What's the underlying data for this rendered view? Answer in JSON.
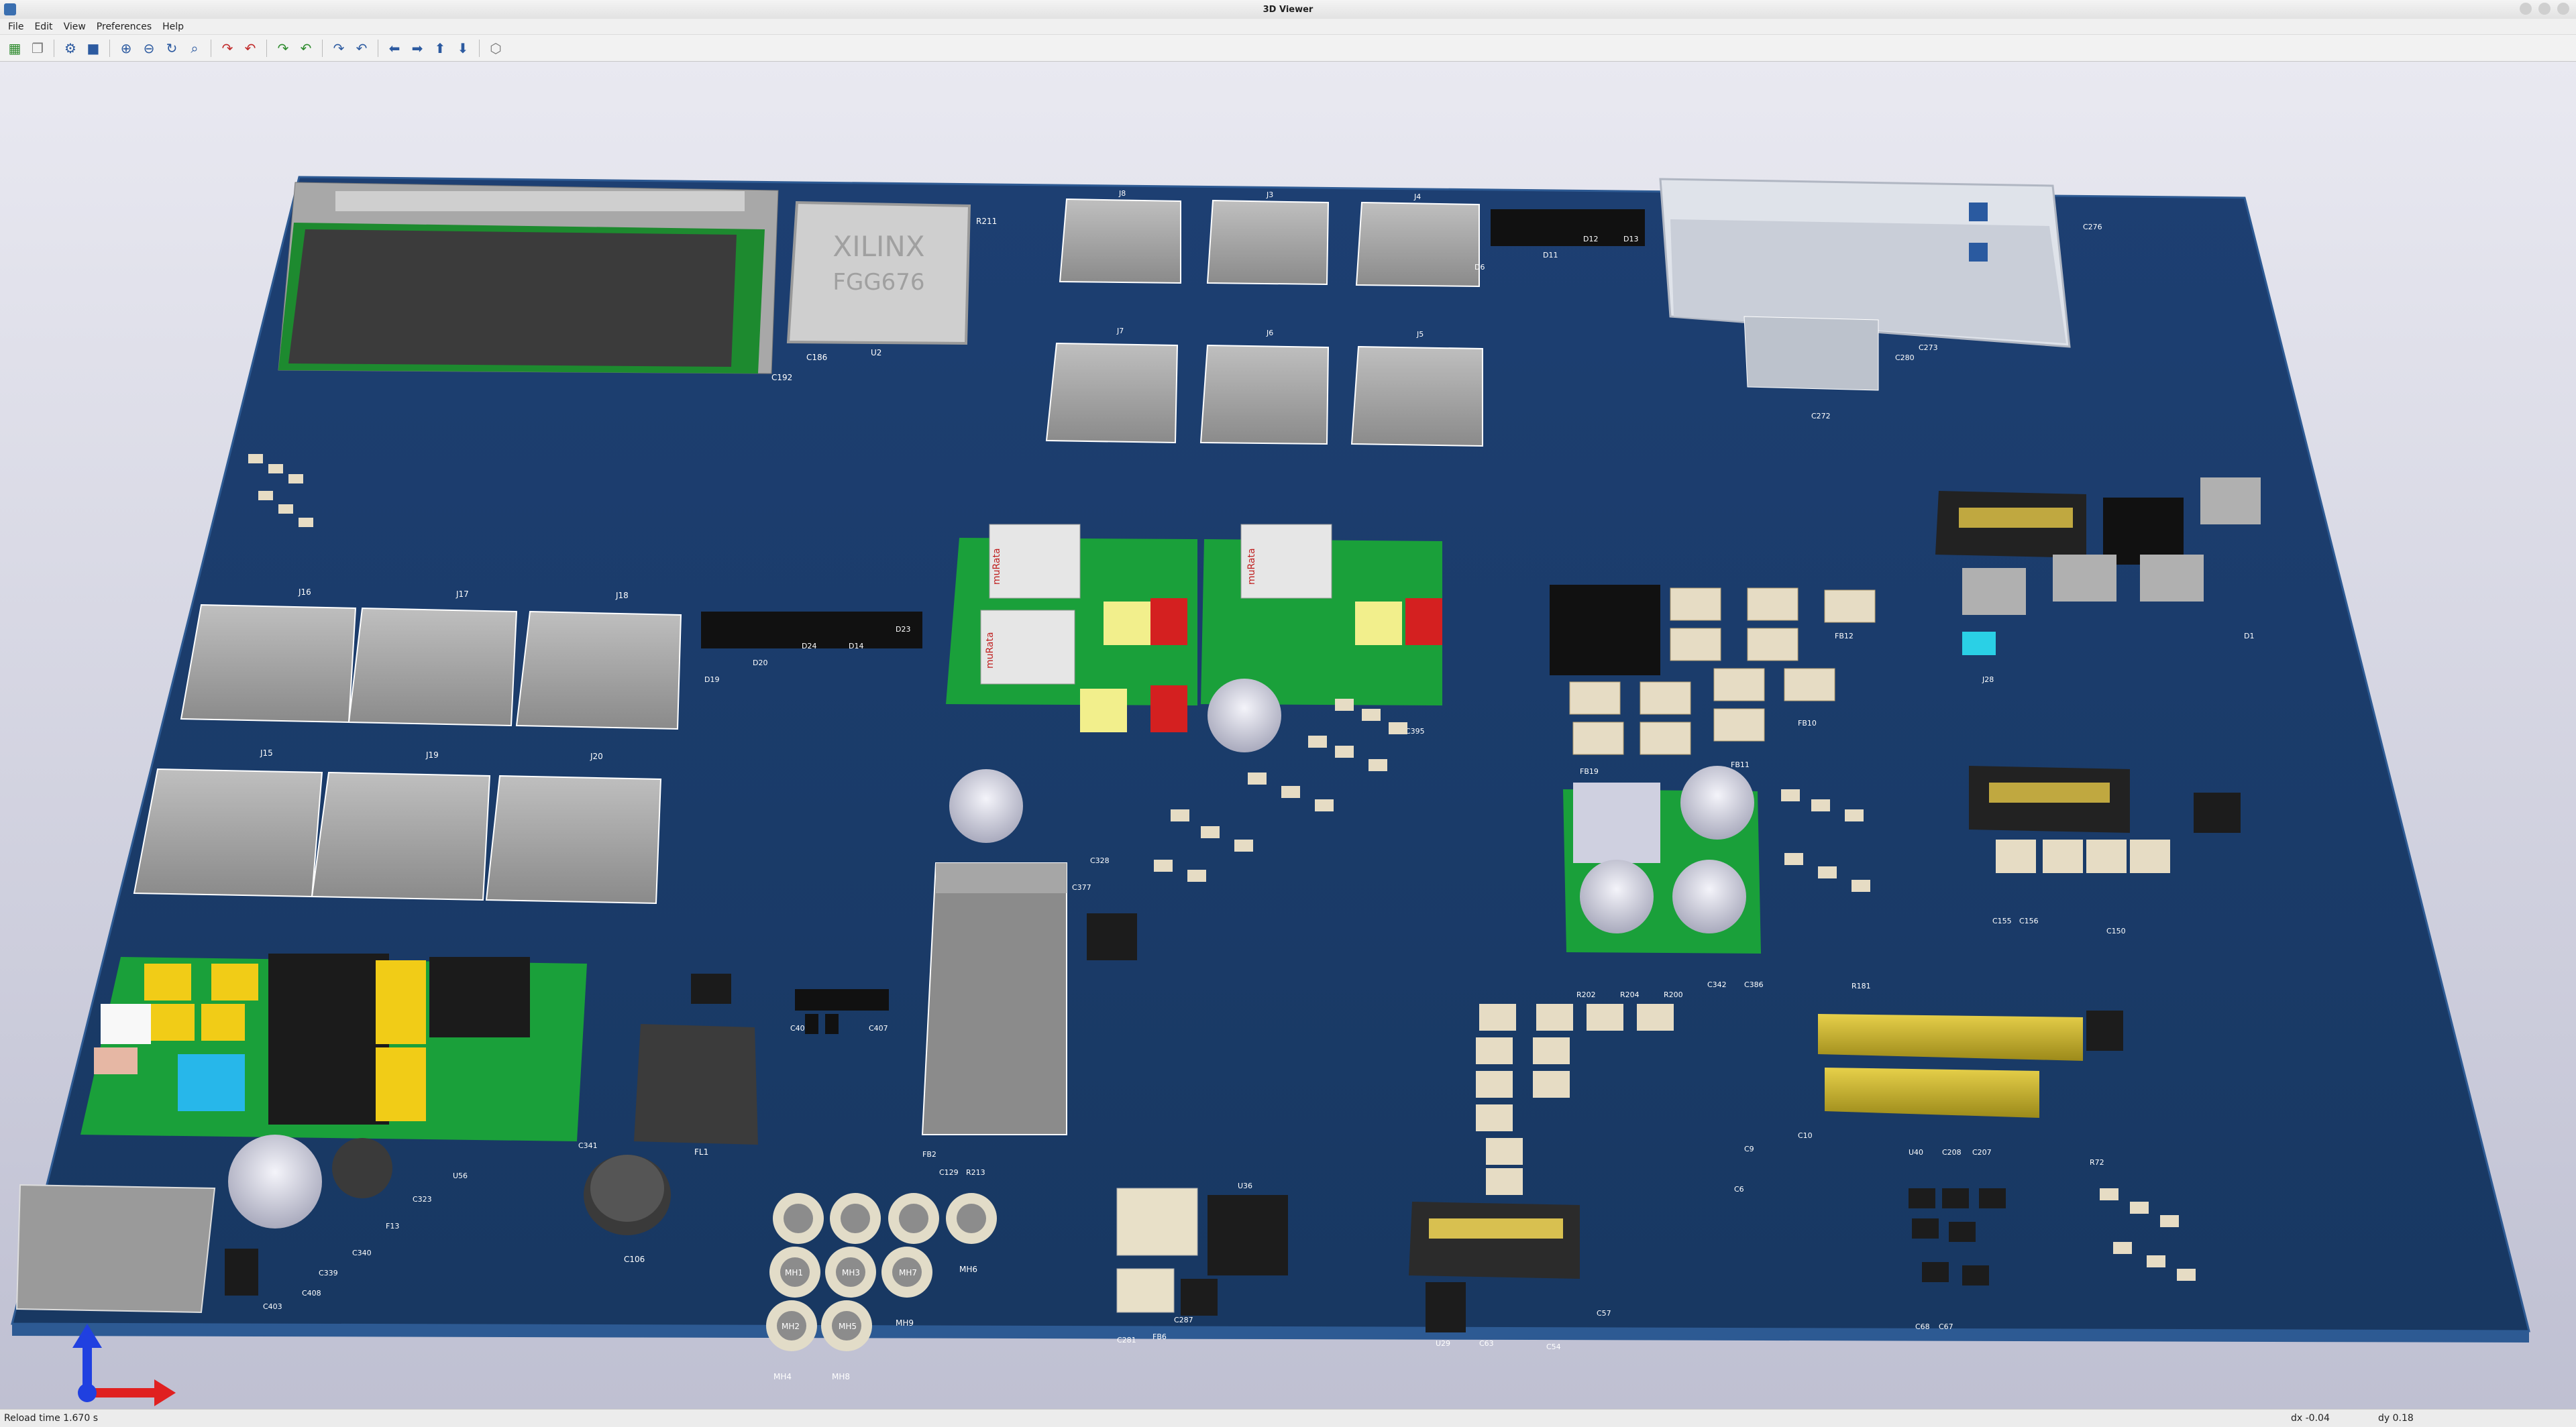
{
  "window": {
    "title": "3D Viewer"
  },
  "menu": [
    "File",
    "Edit",
    "View",
    "Preferences",
    "Help"
  ],
  "toolbar": [
    {
      "icon": "render-raytracing-icon"
    },
    {
      "icon": "copy-image-icon"
    },
    {
      "icon": "options-gear-icon"
    },
    {
      "icon": "render-3d-icon"
    },
    {
      "icon": "zoom-in-icon"
    },
    {
      "icon": "zoom-out-icon"
    },
    {
      "icon": "refresh-icon"
    },
    {
      "icon": "zoom-fit-icon"
    },
    {
      "icon": "rotate-x-cw-icon"
    },
    {
      "icon": "rotate-x-ccw-icon"
    },
    {
      "icon": "rotate-y-cw-icon"
    },
    {
      "icon": "rotate-y-ccw-icon"
    },
    {
      "icon": "rotate-z-cw-icon"
    },
    {
      "icon": "rotate-z-ccw-icon"
    },
    {
      "icon": "pan-left-icon"
    },
    {
      "icon": "pan-right-icon"
    },
    {
      "icon": "pan-up-icon"
    },
    {
      "icon": "pan-down-icon"
    },
    {
      "icon": "ortho-view-icon"
    }
  ],
  "colors": {
    "board": "#1e3f6e",
    "edge": "#2e5a92",
    "green_pcb": "#1aa03a"
  },
  "board_labels": {
    "fpga": "XILINX",
    "fpga_pkg": "FGG676",
    "u2": "U2",
    "r211": "R211",
    "c192": "C192",
    "c186": "C186",
    "j8": "J8",
    "j3": "J3",
    "j4": "J4",
    "j7": "J7",
    "j6": "J6",
    "j5": "J5",
    "j16": "J16",
    "j17": "J17",
    "j18": "J18",
    "j15": "J15",
    "j19": "J19",
    "j20": "J20",
    "j28": "J28",
    "fb12": "FB12",
    "fb10": "FB10",
    "fb11": "FB11",
    "fb19": "FB19",
    "fl1": "FL1",
    "mh1": "MH1",
    "mh2": "MH2",
    "mh3": "MH3",
    "mh4": "MH4",
    "mh5": "MH5",
    "mh6": "MH6",
    "mh7": "MH7",
    "mh8": "MH8",
    "mh9": "MH9",
    "c106": "C106",
    "c341": "C341",
    "u36": "U36",
    "f13": "F13",
    "r202": "R202",
    "r204": "R204",
    "r200": "R200",
    "r72": "R72",
    "c129": "C129",
    "r213": "R213",
    "fb2": "FB2",
    "c155": "C155",
    "c156": "C156",
    "c150": "C150",
    "c377": "C377",
    "c328": "C328",
    "c342": "C342",
    "c386": "C386",
    "r181": "R181",
    "u40": "U40",
    "c68": "C68",
    "c67": "C67",
    "c281": "C281",
    "fb6": "FB6",
    "c287": "C287",
    "c57": "C57",
    "c54": "C54",
    "u29": "U29",
    "c63": "C63",
    "d1": "D1",
    "d20": "D20",
    "d19": "D19",
    "d24": "D24",
    "d14": "D14",
    "d23": "D23",
    "d11": "D11",
    "d12": "D12",
    "d13": "D13",
    "d6": "D6",
    "c406": "C406",
    "c407": "C407",
    "c403": "C403",
    "c408": "C408",
    "c339": "C339",
    "c340": "C340",
    "u56": "U56",
    "c323": "C323",
    "c395": "C395",
    "c208": "C208",
    "c207": "C207",
    "c9": "C9",
    "c10": "C10",
    "c6": "C6",
    "c276": "C276",
    "c273": "C273",
    "c272": "C272",
    "c280": "C280",
    "brand": "muRata"
  },
  "status": {
    "reload": "Reload time 1.670 s",
    "dx": "dx -0.04",
    "dy": "dy 0.18"
  }
}
